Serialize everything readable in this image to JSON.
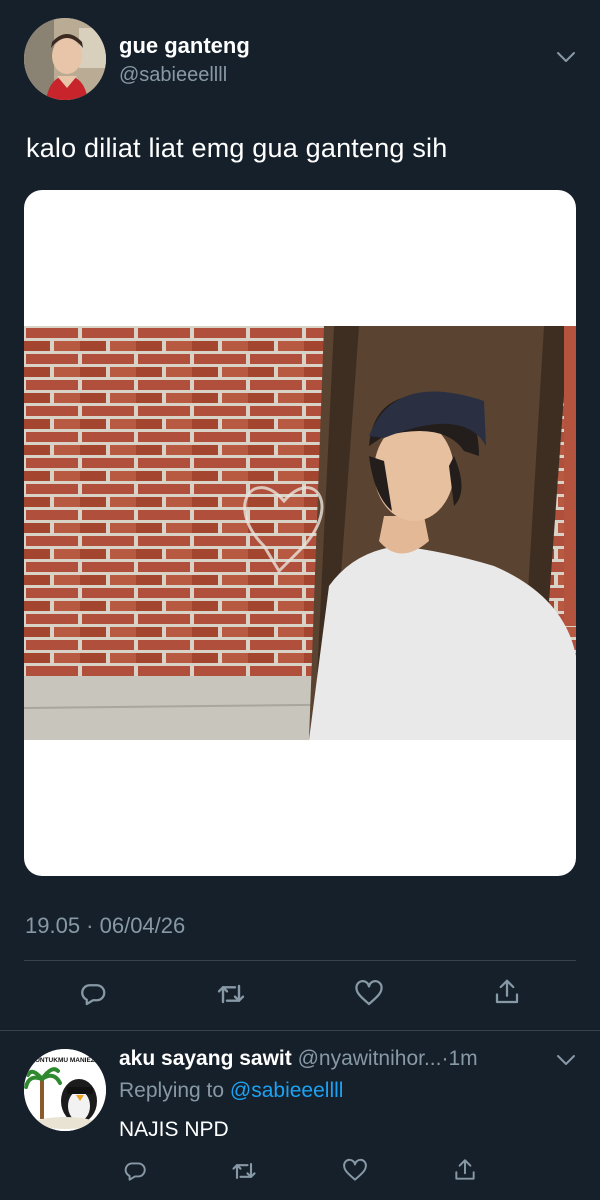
{
  "tweet": {
    "author_name": "gue ganteng",
    "author_handle": "@sabieeellll",
    "text": "kalo diliat liat emg gua ganteng sih",
    "timestamp": "19.05 · 06/04/26"
  },
  "reply": {
    "author_name": "aku sayang sawit",
    "author_handle": "@nyawitnihor...",
    "time": "·1m",
    "replying_prefix": "Replying to",
    "replying_to": "@sabieeellll",
    "text": "NAJIS NPD",
    "avatar_badge": "UNTUKMU MANIEZ"
  },
  "icons": {
    "reply": "reply-icon",
    "retweet": "retweet-icon",
    "like": "heart-icon",
    "share": "share-icon",
    "menu": "chevron-down-icon"
  },
  "colors": {
    "background": "#15202b",
    "secondary_text": "#8899a6",
    "link": "#1da1f2",
    "divider": "#38444d"
  }
}
